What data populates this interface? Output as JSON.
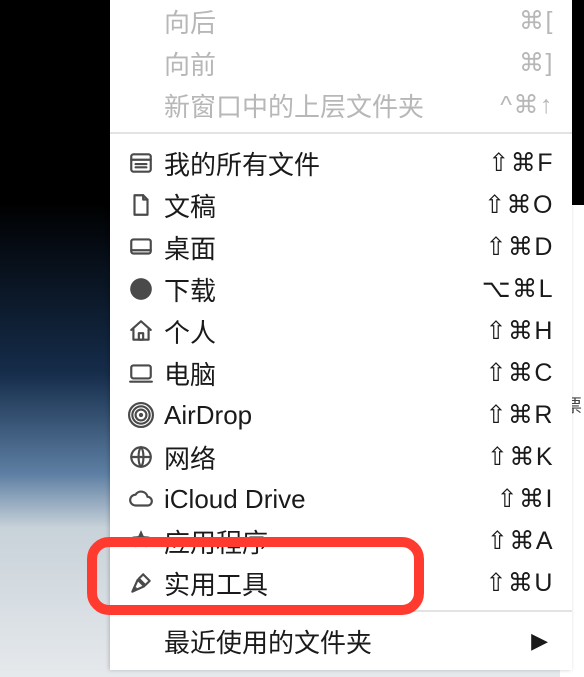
{
  "nav": [
    {
      "name": "back",
      "label": "向后",
      "shortcut": "⌘[",
      "enabled": false
    },
    {
      "name": "forward",
      "label": "向前",
      "shortcut": "⌘]",
      "enabled": false
    },
    {
      "name": "parent-new-win",
      "label": "新窗口中的上层文件夹",
      "shortcut": "^⌘↑",
      "enabled": false
    }
  ],
  "places": [
    {
      "name": "all-my-files",
      "icon": "all-files-icon",
      "label": "我的所有文件",
      "shortcut": "⇧⌘F"
    },
    {
      "name": "documents",
      "icon": "document-icon",
      "label": "文稿",
      "shortcut": "⇧⌘O"
    },
    {
      "name": "desktop",
      "icon": "desktop-icon",
      "label": "桌面",
      "shortcut": "⇧⌘D"
    },
    {
      "name": "downloads",
      "icon": "download-icon",
      "label": "下载",
      "shortcut": "⌥⌘L"
    },
    {
      "name": "home",
      "icon": "home-icon",
      "label": "个人",
      "shortcut": "⇧⌘H"
    },
    {
      "name": "computer",
      "icon": "computer-icon",
      "label": "电脑",
      "shortcut": "⇧⌘C"
    },
    {
      "name": "airdrop",
      "icon": "airdrop-icon",
      "label": "AirDrop",
      "shortcut": "⇧⌘R"
    },
    {
      "name": "network",
      "icon": "network-icon",
      "label": "网络",
      "shortcut": "⇧⌘K"
    },
    {
      "name": "icloud-drive",
      "icon": "cloud-icon",
      "label": "iCloud Drive",
      "shortcut": "⇧⌘I"
    },
    {
      "name": "applications",
      "icon": "apps-icon",
      "label": "应用程序",
      "shortcut": "⇧⌘A"
    },
    {
      "name": "utilities",
      "icon": "utilities-icon",
      "label": "实用工具",
      "shortcut": "⇧⌘U"
    }
  ],
  "recent": {
    "label": "最近使用的文件夹"
  },
  "highlighted": "utilities",
  "stray_text": "票"
}
